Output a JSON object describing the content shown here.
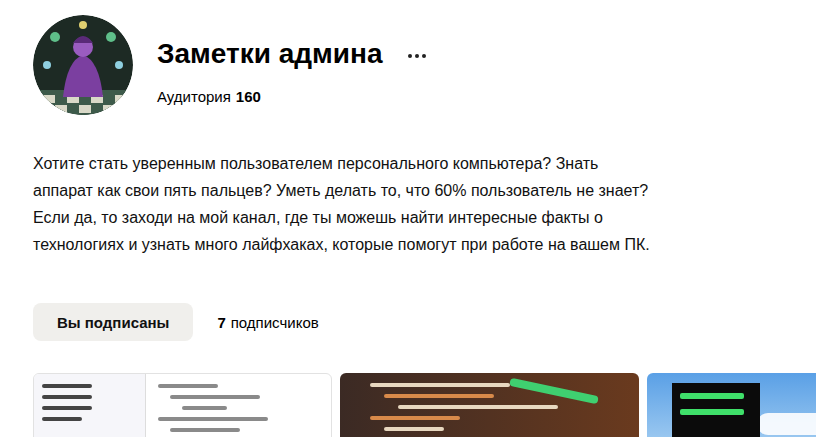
{
  "channel": {
    "title": "Заметки админа",
    "audience_label": "Аудитория",
    "audience_value": "160",
    "description": "Хотите стать уверенным пользователем персонального компьютера? Знать аппарат как свои пять пальцев? Уметь делать то, что 60% пользователь не знает? Если да, то заходи на мой канал, где ты можешь найти интересные факты о технологиях и узнать много лайфхаках, которые помогут при работе на вашем ПК."
  },
  "subscribe_button": {
    "label": "Вы подписаны",
    "subscribed": true
  },
  "subscribers": {
    "count": "7",
    "label": "подписчиков"
  },
  "articles": [
    {
      "kind": "code-light"
    },
    {
      "kind": "code-dark"
    },
    {
      "kind": "binary"
    }
  ]
}
